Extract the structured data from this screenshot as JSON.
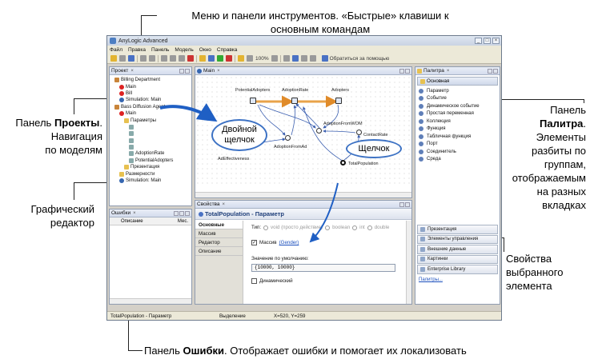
{
  "callouts": {
    "top_line1": "Меню и панели инструментов. «Быстрые» клавиши к",
    "top_line2": "основным командам",
    "projects_bold": "Проекты",
    "projects_line1_prefix": "Панель ",
    "projects_line1_suffix": ".",
    "projects_line2": "Навигация",
    "projects_line3": "по моделям",
    "palette_line1": "Панель",
    "palette_bold": "Палитра",
    "palette_bold_suffix": ".",
    "palette_line3": "Элементы",
    "palette_line4": "разбиты по",
    "palette_line5": "группам,",
    "palette_line6": "отображаемым",
    "palette_line7": "на разных",
    "palette_line8": "вкладках",
    "editor_line1": "Графический",
    "editor_line2": "редактор",
    "properties_line1": "Свойства",
    "properties_line2": "выбранного",
    "properties_line3": "элемента",
    "errors_prefix": "Панель ",
    "errors_bold": "Ошибки",
    "errors_suffix": ". Отображает ошибки и помогает их локализовать",
    "double_click_line1": "Двойной",
    "double_click_line2": "щелчок",
    "click": "Щелчок"
  },
  "window": {
    "title": "AnyLogic Advanced",
    "menu": [
      "Файл",
      "Правка",
      "Панель",
      "Модель",
      "Окно",
      "Справка"
    ],
    "zoom": "100%",
    "help_button": "Обратиться за помощью"
  },
  "projects_panel": {
    "title": "Проект",
    "items": [
      {
        "label": "Billing Department",
        "icon": "model",
        "indent": 0
      },
      {
        "label": "Main",
        "icon": "agent",
        "indent": 1
      },
      {
        "label": "Bill",
        "icon": "agent",
        "indent": 1
      },
      {
        "label": "Simulation: Main",
        "icon": "exp",
        "indent": 1
      },
      {
        "label": "Bass Diffusion Agent",
        "icon": "model",
        "indent": 0
      },
      {
        "label": "Main",
        "icon": "agent",
        "indent": 1
      },
      {
        "label": "Параметры",
        "icon": "folder",
        "indent": 2
      },
      {
        "label": "",
        "icon": "param",
        "indent": 3
      },
      {
        "label": "",
        "icon": "param",
        "indent": 3
      },
      {
        "label": "",
        "icon": "param",
        "indent": 3
      },
      {
        "label": "",
        "icon": "param",
        "indent": 3
      },
      {
        "label": "AdoptionRate",
        "icon": "param",
        "indent": 3
      },
      {
        "label": "PotentialAdopters",
        "icon": "param",
        "indent": 3
      },
      {
        "label": "Презентация",
        "icon": "folder",
        "indent": 2
      },
      {
        "label": "Размерности",
        "icon": "folder",
        "indent": 1
      },
      {
        "label": "Simulation: Main",
        "icon": "exp",
        "indent": 1
      }
    ]
  },
  "editor": {
    "tab": "Main",
    "labels": {
      "potential_adopters": "PotentialAdopters",
      "adoption_rate": "AdoptionRate",
      "adopters": "Adopters",
      "adoption_from_wom": "AdoptionFromWOM",
      "contact_rate": "ContactRate",
      "adoption_from_ad": "AdoptionFromAd",
      "ad_effectiveness": "AdEffectiveness",
      "total_population": "TotalPopulation"
    }
  },
  "errors_panel": {
    "title": "Ошибки",
    "col_description": "Описание",
    "col_location": "Мес."
  },
  "properties_panel": {
    "title": "Свойства",
    "heading": "TotalPopulation - Параметр",
    "tabs": [
      "Основные",
      "Массив",
      "Редактор",
      "Описание"
    ],
    "type_label": "Тип:",
    "type_options": [
      "void (просто действие)",
      "boolean",
      "int",
      "double"
    ],
    "array_label": "Массив",
    "array_link": "(Gender)",
    "default_label": "Значение по умолчанию:",
    "default_value": "{10000, 10000}",
    "dynamic_label": "Динамический"
  },
  "palette_panel": {
    "title": "Палитра",
    "section": "Основная",
    "items": [
      "Параметр",
      "Событие",
      "Динамическое событие",
      "Простая переменная",
      "Коллекция",
      "Функция",
      "Табличная функция",
      "Порт",
      "Соединитель",
      "Среда"
    ],
    "groups": [
      "Презентация",
      "Элементы управления",
      "Внешние данные",
      "Картинки",
      "Enterprise Library"
    ],
    "more_link": "Палитры..."
  },
  "statusbar": {
    "selection": "TotalPopulation - Параметр",
    "mode": "Выделение",
    "coords": "X=520, Y=259"
  }
}
